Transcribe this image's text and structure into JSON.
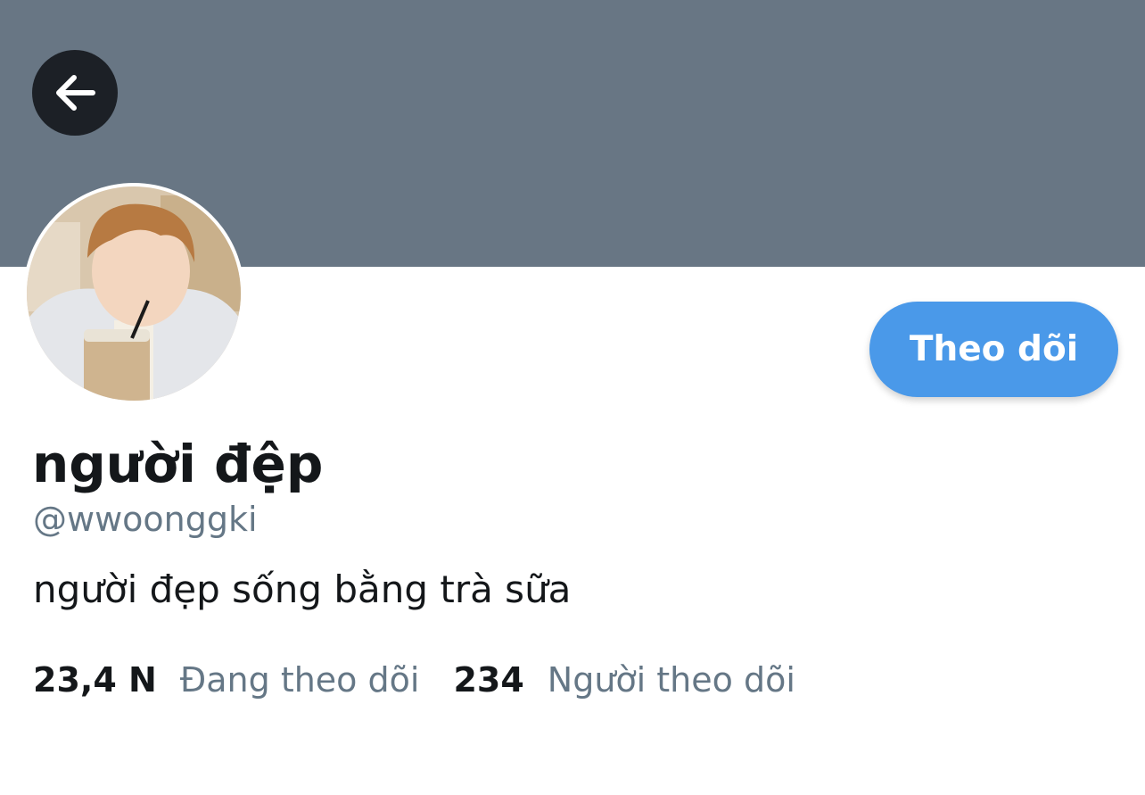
{
  "header": {
    "back_icon": "arrow-left-icon",
    "banner_color": "#687684"
  },
  "profile": {
    "display_name": "người đệp",
    "handle": "@wwoonggki",
    "bio": "người đẹp sống bằng trà sữa",
    "follow_button_label": "Theo dõi",
    "accent_color": "#4a99e9"
  },
  "stats": {
    "following_count": "23,4 N",
    "following_label": "Đang theo dõi",
    "followers_count": "234",
    "followers_label": "Người theo dõi"
  }
}
